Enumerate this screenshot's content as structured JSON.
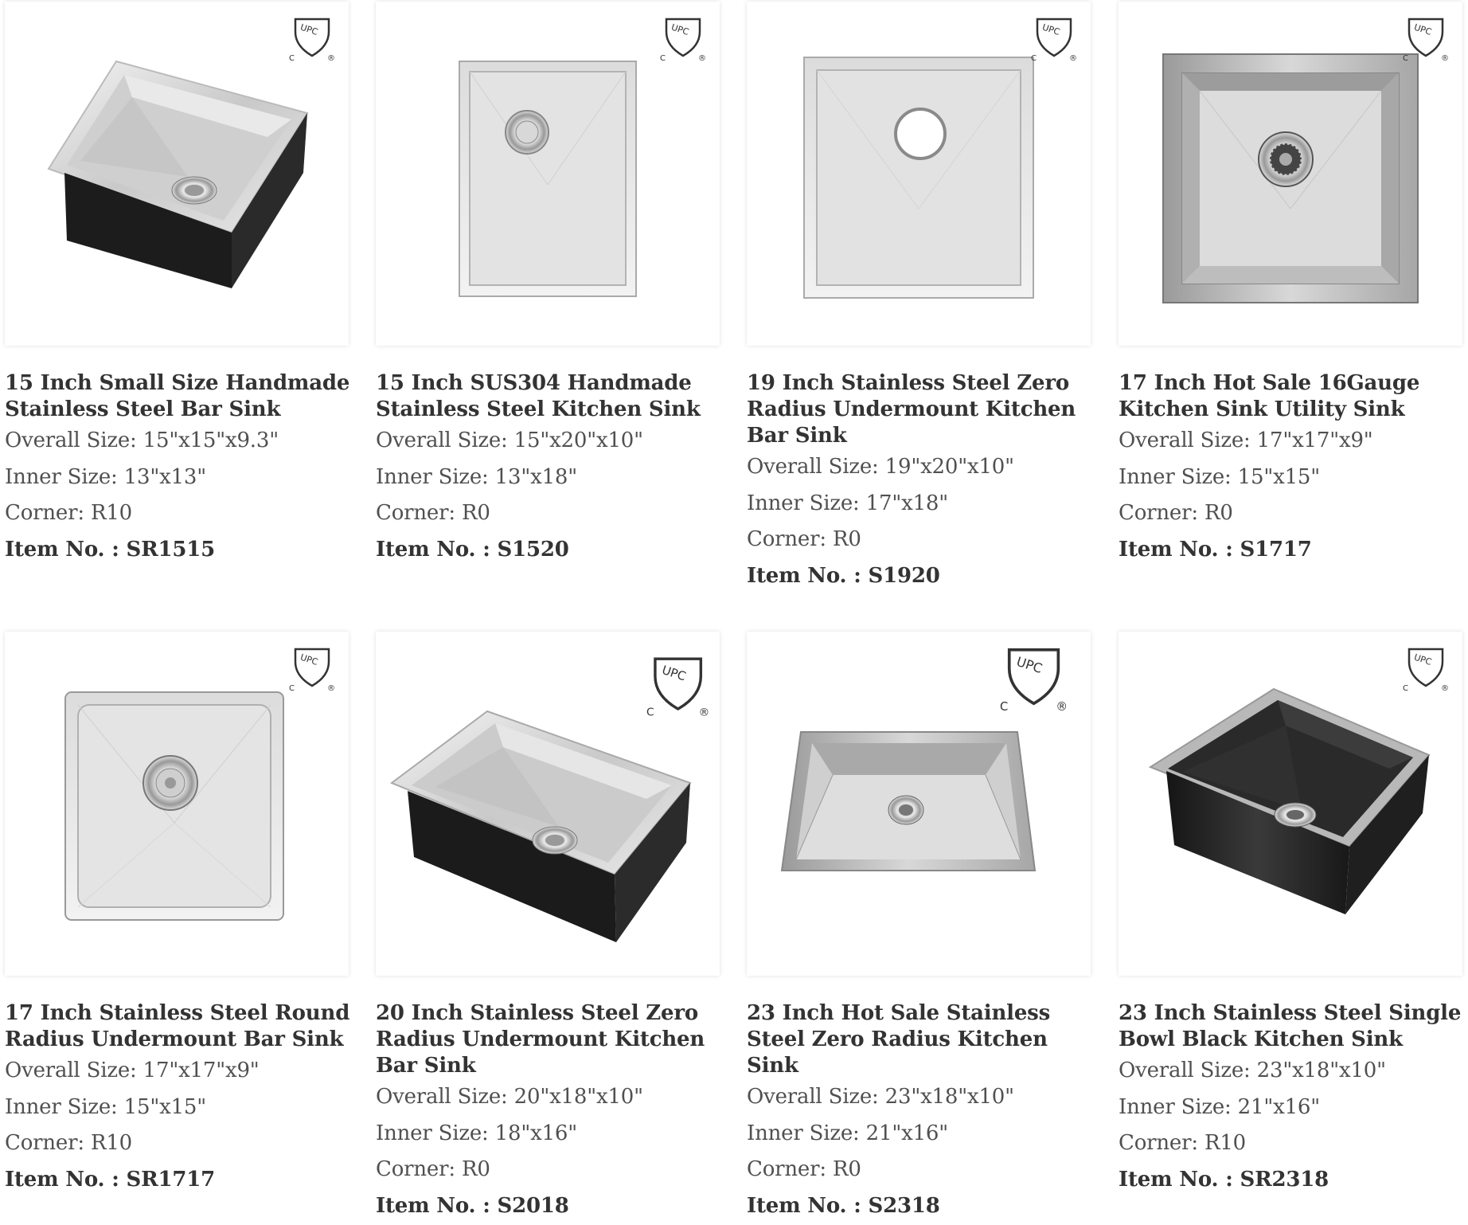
{
  "products": [
    {
      "title": "15 Inch Small Size Handmade Stainless Steel Bar Sink",
      "overall": "Overall Size: 15\"x15\"x9.3\"",
      "inner": "Inner Size: 13\"x13\"",
      "corner": "Corner: R10",
      "item_label": "Item No. :",
      "item_no": "SR1515",
      "image_icon": "angled-stainless-sink-image",
      "cert_text": "UPC"
    },
    {
      "title": "15 Inch SUS304 Handmade Stainless Steel Kitchen Sink",
      "overall": "Overall Size: 15\"x20\"x10\"",
      "inner": "Inner Size: 13\"x18\"",
      "corner": "Corner: R0",
      "item_label": "Item No. :",
      "item_no": "S1520",
      "image_icon": "topdown-stainless-sink-image",
      "cert_text": "UPC"
    },
    {
      "title": "19 Inch Stainless Steel Zero Radius Undermount Kitchen Bar Sink",
      "overall": "Overall Size: 19\"x20\"x10\"",
      "inner": "Inner Size: 17\"x18\"",
      "corner": "Corner: R0",
      "item_label": "Item No. :",
      "item_no": "S1920",
      "image_icon": "topdown-stainless-sink-image",
      "cert_text": "UPC"
    },
    {
      "title": "17 Inch Hot Sale 16Gauge Kitchen Sink Utility Sink",
      "overall": "Overall Size: 17\"x17\"x9\"",
      "inner": "Inner Size: 15\"x15\"",
      "corner": "Corner: R0",
      "item_label": "Item No. :",
      "item_no": "S1717",
      "image_icon": "topdown-deep-sink-image",
      "cert_text": "UPC"
    },
    {
      "title": "17 Inch Stainless Steel Round Radius Undermount Bar Sink",
      "overall": "Overall Size: 17\"x17\"x9\"",
      "inner": "Inner Size: 15\"x15\"",
      "corner": "Corner: R10",
      "item_label": "Item No. :",
      "item_no": "SR1717",
      "image_icon": "topdown-round-sink-image",
      "cert_text": "UPC"
    },
    {
      "title": "20 Inch Stainless Steel Zero Radius Undermount Kitchen Bar Sink",
      "overall": "Overall Size: 20\"x18\"x10\"",
      "inner": "Inner Size: 18\"x16\"",
      "corner": "Corner: R0",
      "item_label": "Item No. :",
      "item_no": "S2018",
      "image_icon": "angled-stainless-sink-image",
      "cert_text": "UPC"
    },
    {
      "title": "23 Inch Hot Sale Stainless Steel Zero Radius Kitchen Sink",
      "overall": "Overall Size: 23\"x18\"x10\"",
      "inner": "Inner Size: 21\"x16\"",
      "corner": "Corner: R0",
      "item_label": "Item No. :",
      "item_no": "S2318",
      "image_icon": "front-stainless-sink-image",
      "cert_text": "UPC"
    },
    {
      "title": "23 Inch Stainless Steel Single Bowl Black Kitchen Sink",
      "overall": "Overall Size: 23\"x18\"x10\"",
      "inner": "Inner Size: 21\"x16\"",
      "corner": "Corner: R10",
      "item_label": "Item No. :",
      "item_no": "SR2318",
      "image_icon": "angled-black-sink-image",
      "cert_text": "UPC"
    }
  ],
  "colors": {
    "title": "#333333",
    "spec": "#505050",
    "steel_light": "#e6e6e6",
    "steel_mid": "#bdbdbd",
    "steel_dark": "#8a8a8a",
    "black_body": "#1e1e1e"
  }
}
